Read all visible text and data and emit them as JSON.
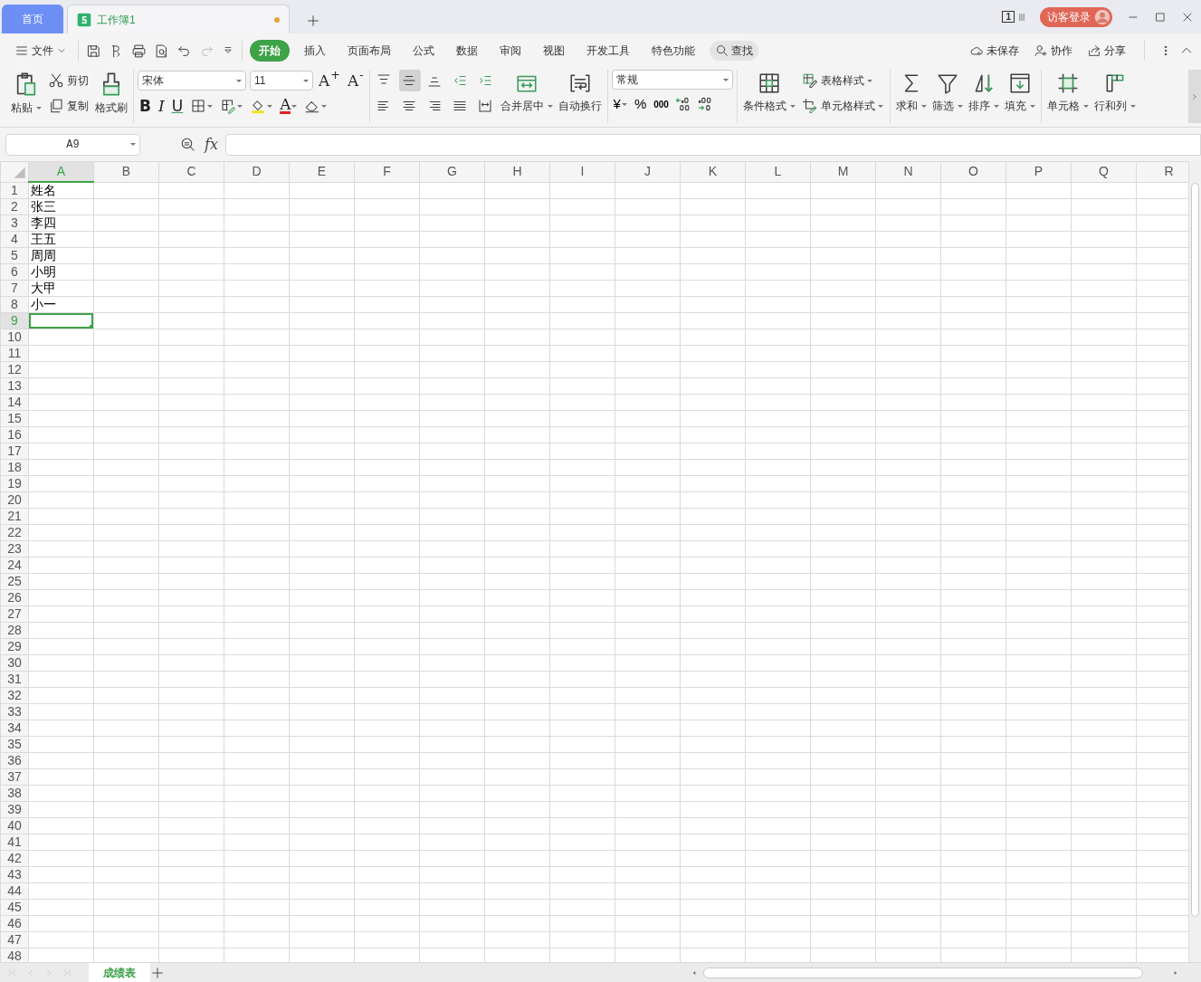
{
  "title_bar": {
    "tabs": [
      {
        "label": "首页",
        "kind": "home",
        "selected": false,
        "modified": false
      },
      {
        "label": "工作簿1",
        "kind": "workbook",
        "selected": true,
        "modified": true
      }
    ],
    "window_count": "1",
    "login_button": "访客登录"
  },
  "menu_bar": {
    "file_menu": "文件",
    "ribbon_tabs": [
      {
        "label": "开始",
        "selected": true
      },
      {
        "label": "插入",
        "selected": false
      },
      {
        "label": "页面布局",
        "selected": false
      },
      {
        "label": "公式",
        "selected": false
      },
      {
        "label": "数据",
        "selected": false
      },
      {
        "label": "审阅",
        "selected": false
      },
      {
        "label": "视图",
        "selected": false
      },
      {
        "label": "开发工具",
        "selected": false
      },
      {
        "label": "特色功能",
        "selected": false
      }
    ],
    "search": "查找",
    "actions": [
      {
        "label": "未保存",
        "kind": "cloud"
      },
      {
        "label": "协作",
        "kind": "collab"
      },
      {
        "label": "分享",
        "kind": "share"
      }
    ]
  },
  "ribbon": {
    "clipboard": {
      "paste": "粘贴",
      "cut": "剪切",
      "copy": "复制",
      "format_painter": "格式刷"
    },
    "font": {
      "name": "宋体",
      "size": "11",
      "grow": "A$^{+}$",
      "shrink": "A$^{-}$",
      "bold": "B",
      "italic": "I",
      "underline": "U",
      "font_color": "A"
    },
    "alignment": {
      "buttons": [
        {
          "kind": "top",
          "selected": false
        },
        {
          "kind": "middle",
          "selected": true
        },
        {
          "kind": "bottom",
          "selected": false
        },
        {
          "kind": "outdent",
          "selected": false
        },
        {
          "kind": "indent",
          "selected": false
        },
        {
          "kind": "left",
          "selected": false
        },
        {
          "kind": "center",
          "selected": false
        },
        {
          "kind": "right",
          "selected": false
        },
        {
          "kind": "justify",
          "selected": false
        },
        {
          "kind": "distribute",
          "selected": false
        }
      ],
      "merge": "合并居中",
      "wrap": "自动换行"
    },
    "number": {
      "format": "常规",
      "currency": "¥",
      "percent": "%",
      "thousands": "000"
    },
    "styles": {
      "conditional": "条件格式",
      "table_style": "表格样式",
      "cell_style": "单元格样式"
    },
    "editing": [
      {
        "label": "求和",
        "kind": "sum"
      },
      {
        "label": "筛选",
        "kind": "filter"
      },
      {
        "label": "排序",
        "kind": "sort"
      },
      {
        "label": "填充",
        "kind": "fill"
      },
      {
        "label": "单元格",
        "kind": "cell"
      },
      {
        "label": "行和列",
        "kind": "rowcol"
      }
    ]
  },
  "formula_bar": {
    "name_box": "A9",
    "function_label": "fx"
  },
  "sheet": {
    "columns": [
      {
        "label": "A",
        "selected": true
      },
      {
        "label": "B",
        "selected": false
      },
      {
        "label": "C",
        "selected": false
      },
      {
        "label": "D",
        "selected": false
      },
      {
        "label": "E",
        "selected": false
      },
      {
        "label": "F",
        "selected": false
      },
      {
        "label": "G",
        "selected": false
      },
      {
        "label": "H",
        "selected": false
      },
      {
        "label": "I",
        "selected": false
      },
      {
        "label": "J",
        "selected": false
      },
      {
        "label": "K",
        "selected": false
      },
      {
        "label": "L",
        "selected": false
      },
      {
        "label": "M",
        "selected": false
      },
      {
        "label": "N",
        "selected": false
      },
      {
        "label": "O",
        "selected": false
      },
      {
        "label": "P",
        "selected": false
      },
      {
        "label": "Q",
        "selected": false
      },
      {
        "label": "R",
        "selected": false
      }
    ],
    "rows": [
      {
        "label": "1",
        "selected": false,
        "cells": [
          "姓名"
        ]
      },
      {
        "label": "2",
        "selected": false,
        "cells": [
          "张三"
        ]
      },
      {
        "label": "3",
        "selected": false,
        "cells": [
          "李四"
        ]
      },
      {
        "label": "4",
        "selected": false,
        "cells": [
          "王五"
        ]
      },
      {
        "label": "5",
        "selected": false,
        "cells": [
          "周周"
        ]
      },
      {
        "label": "6",
        "selected": false,
        "cells": [
          "小明"
        ]
      },
      {
        "label": "7",
        "selected": false,
        "cells": [
          "大甲"
        ]
      },
      {
        "label": "8",
        "selected": false,
        "cells": [
          "小一"
        ]
      },
      {
        "label": "9",
        "selected": true
      },
      {
        "label": "10",
        "selected": false
      },
      {
        "label": "11",
        "selected": false
      },
      {
        "label": "12",
        "selected": false
      },
      {
        "label": "13",
        "selected": false
      },
      {
        "label": "14",
        "selected": false
      },
      {
        "label": "15",
        "selected": false
      },
      {
        "label": "16",
        "selected": false
      },
      {
        "label": "17",
        "selected": false
      },
      {
        "label": "18",
        "selected": false
      },
      {
        "label": "19",
        "selected": false
      },
      {
        "label": "20",
        "selected": false
      },
      {
        "label": "21",
        "selected": false
      },
      {
        "label": "22",
        "selected": false
      },
      {
        "label": "23",
        "selected": false
      },
      {
        "label": "24",
        "selected": false
      },
      {
        "label": "25",
        "selected": false
      },
      {
        "label": "26",
        "selected": false
      },
      {
        "label": "27",
        "selected": false
      },
      {
        "label": "28",
        "selected": false
      },
      {
        "label": "29",
        "selected": false
      },
      {
        "label": "30",
        "selected": false
      },
      {
        "label": "31",
        "selected": false
      },
      {
        "label": "32",
        "selected": false
      },
      {
        "label": "33",
        "selected": false
      },
      {
        "label": "34",
        "selected": false
      },
      {
        "label": "35",
        "selected": false
      },
      {
        "label": "36",
        "selected": false
      },
      {
        "label": "37",
        "selected": false
      },
      {
        "label": "38",
        "selected": false
      },
      {
        "label": "39",
        "selected": false
      },
      {
        "label": "40",
        "selected": false
      },
      {
        "label": "41",
        "selected": false
      },
      {
        "label": "42",
        "selected": false
      },
      {
        "label": "43",
        "selected": false
      },
      {
        "label": "44",
        "selected": false
      },
      {
        "label": "45",
        "selected": false
      },
      {
        "label": "46",
        "selected": false
      },
      {
        "label": "47",
        "selected": false
      },
      {
        "label": "48",
        "selected": false
      }
    ]
  },
  "sheet_tabs": [
    {
      "label": "成绩表",
      "selected": true
    }
  ]
}
